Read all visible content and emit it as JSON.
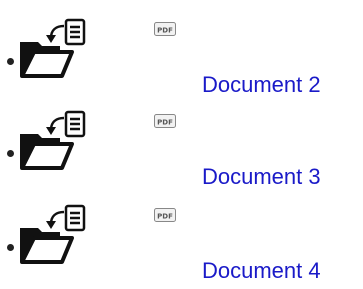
{
  "documents": [
    {
      "link_text": "Document 2",
      "icon_badge": "PDF",
      "icon": "folder-import-icon"
    },
    {
      "link_text": "Document 3",
      "icon_badge": "PDF",
      "icon": "folder-import-icon"
    },
    {
      "link_text": "Document 4",
      "icon_badge": "PDF",
      "icon": "folder-import-icon"
    }
  ]
}
